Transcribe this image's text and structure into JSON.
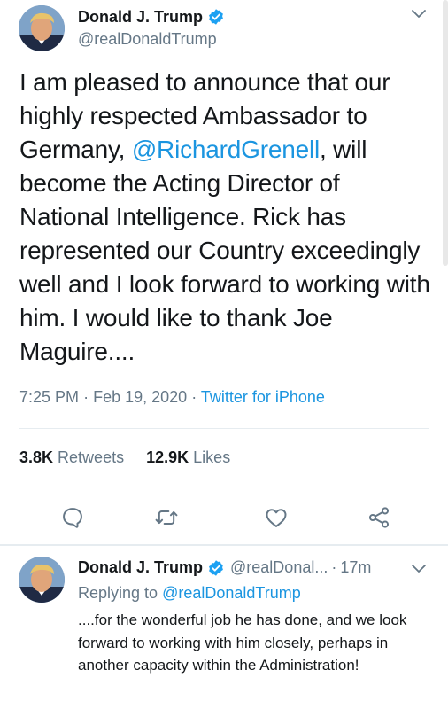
{
  "tweet": {
    "author_name": "Donald J. Trump",
    "author_handle": "@realDonaldTrump",
    "text_before": "I am pleased to announce that our highly respected Ambassador to Germany, ",
    "mention": "@RichardGrenell",
    "text_after": ", will become the Acting Director of National Intelligence. Rick has represented our Country exceedingly well and I look forward to working with him. I would like to thank Joe Maguire....",
    "time": "7:25 PM",
    "date": "Feb 19, 2020",
    "separator": "·",
    "source": "Twitter for iPhone",
    "retweets_count": "3.8K",
    "retweets_label": "Retweets",
    "likes_count": "12.9K",
    "likes_label": "Likes"
  },
  "reply": {
    "author_name": "Donald J. Trump",
    "author_handle": "@realDonal...",
    "separator": "·",
    "time_ago": "17m",
    "replying_to_label": "Replying to",
    "replying_to_handle": "@realDonaldTrump",
    "text": "....for the wonderful job he has done, and we look forward to working with him closely, perhaps in another capacity within the Administration!"
  },
  "icons": {
    "verified": "verified-badge-icon",
    "caret": "chevron-down-icon",
    "reply": "reply-icon",
    "retweet": "retweet-icon",
    "like": "heart-icon",
    "share": "share-icon"
  },
  "colors": {
    "accent": "#1b95e0",
    "secondary_text": "#657786",
    "primary_text": "#14171a",
    "divider": "#e6ecf0"
  }
}
